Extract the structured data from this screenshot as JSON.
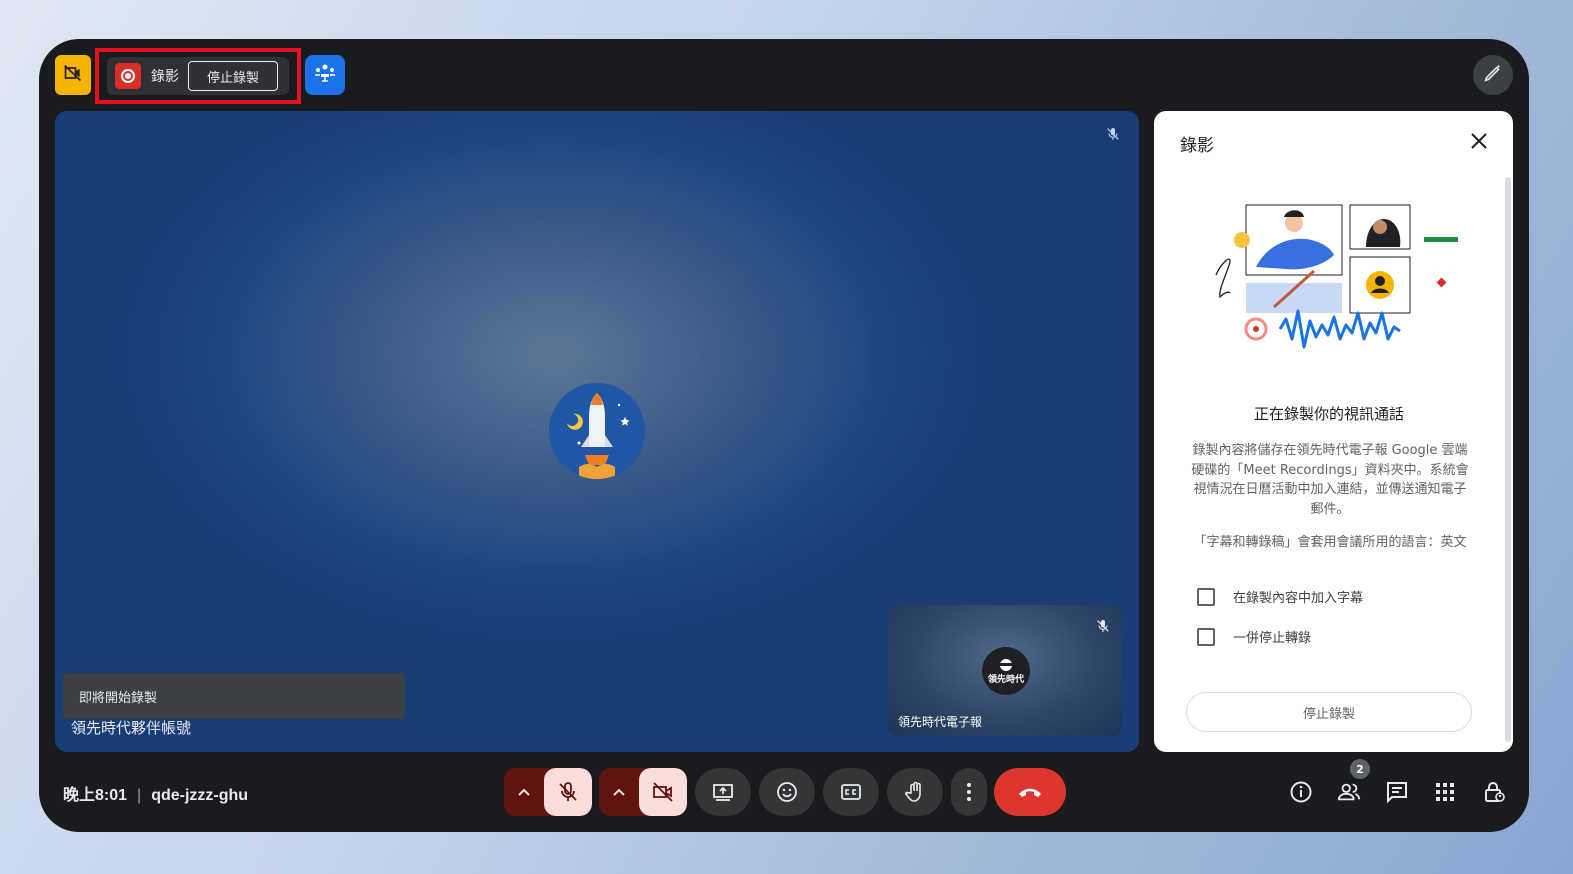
{
  "recording_chip": {
    "label": "錄影",
    "stop_label": "停止錄製"
  },
  "stage": {
    "toast": "即將開始錄製",
    "main_participant": "領先時代夥伴帳號",
    "pip_participant": "領先時代電子報",
    "pip_avatar_text": "領先時代"
  },
  "panel": {
    "title": "錄影",
    "heading": "正在錄製你的視訊通話",
    "body": "錄製內容將儲存在領先時代電子報 Google 雲端硬碟的「Meet Recordings」資料夾中。系統會視情況在日曆活動中加入連結，並傳送通知電子郵件。",
    "language_note": "「字幕和轉錄稿」會套用會議所用的語言：英文",
    "checkboxes": [
      {
        "label": "在錄製內容中加入字幕",
        "checked": false
      },
      {
        "label": "一併停止轉錄",
        "checked": false
      }
    ],
    "stop_button": "停止錄製"
  },
  "bottom_bar": {
    "time": "晚上8:01",
    "meeting_code": "qde-jzzz-ghu",
    "people_count": "2"
  },
  "icons": {
    "top_left": "video-hidden-icon",
    "companion": "companion-mode-icon",
    "top_right": "pen-sparkle-icon",
    "mic": "mic-off-icon",
    "camera": "camera-off-icon",
    "present": "present-screen-icon",
    "emoji": "emoji-icon",
    "captions": "captions-icon",
    "raise_hand": "raise-hand-icon",
    "more": "more-vert-icon",
    "end_call": "end-call-icon",
    "info": "info-icon",
    "people": "people-icon",
    "chat": "chat-icon",
    "activities": "apps-grid-icon",
    "host_controls": "lock-person-icon"
  },
  "colors": {
    "record_red": "#d93025",
    "highlight_red": "#e5101d",
    "end_call_red": "#dc362e",
    "companion_blue": "#1a73e8",
    "hidden_yellow": "#f4b400"
  }
}
